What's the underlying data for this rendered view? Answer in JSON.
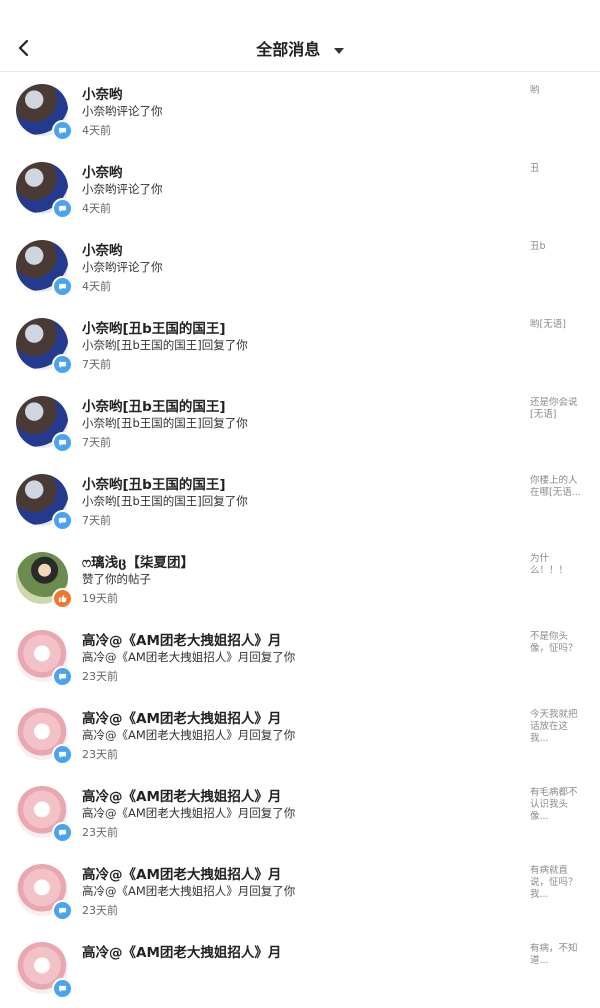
{
  "header": {
    "title": "全部消息",
    "back_icon": "chevron-left-icon",
    "dropdown_icon": "caret-down-icon"
  },
  "colors": {
    "comment_badge": "#4aa3f0",
    "like_badge": "#f2762e",
    "divider": "#e6e6e6"
  },
  "messages": [
    {
      "name": "小奈哟",
      "action": "小奈哟评论了你",
      "time": "4天前",
      "preview": "哟",
      "avatar": "basketball-player",
      "badge": "comment-icon"
    },
    {
      "name": "小奈哟",
      "action": "小奈哟评论了你",
      "time": "4天前",
      "preview": "丑",
      "avatar": "basketball-player",
      "badge": "comment-icon"
    },
    {
      "name": "小奈哟",
      "action": "小奈哟评论了你",
      "time": "4天前",
      "preview": "丑b",
      "avatar": "basketball-player",
      "badge": "comment-icon"
    },
    {
      "name": "小奈哟[丑b王国的国王]",
      "action": "小奈哟[丑b王国的国王]回复了你",
      "time": "7天前",
      "preview": "哟[无语]",
      "avatar": "basketball-player",
      "badge": "comment-icon"
    },
    {
      "name": "小奈哟[丑b王国的国王]",
      "action": "小奈哟[丑b王国的国王]回复了你",
      "time": "7天前",
      "preview": "还是你会说[无语]",
      "avatar": "basketball-player",
      "badge": "comment-icon"
    },
    {
      "name": "小奈哟[丑b王国的国王]",
      "action": "小奈哟[丑b王国的国王]回复了你",
      "time": "7天前",
      "preview": "你楼上的人在哪[无语...",
      "avatar": "basketball-player",
      "badge": "comment-icon"
    },
    {
      "name": "ෆ璃浅ც【柒夏团】",
      "action": "赞了你的帖子",
      "time": "19天前",
      "preview": "为什么！！！",
      "avatar": "girl-photo",
      "badge": "thumbs-up-icon"
    },
    {
      "name": "高冷@《AM团老大拽姐招人》月",
      "action": "高冷@《AM团老大拽姐招人》月回复了你",
      "time": "23天前",
      "preview": "不是你头像，怔吗？",
      "avatar": "anime-girl",
      "badge": "comment-icon"
    },
    {
      "name": "高冷@《AM团老大拽姐招人》月",
      "action": "高冷@《AM团老大拽姐招人》月回复了你",
      "time": "23天前",
      "preview": "今天我就把话放在这我...",
      "avatar": "anime-girl",
      "badge": "comment-icon"
    },
    {
      "name": "高冷@《AM团老大拽姐招人》月",
      "action": "高冷@《AM团老大拽姐招人》月回复了你",
      "time": "23天前",
      "preview": "有毛病都不认识我头像...",
      "avatar": "anime-girl",
      "badge": "comment-icon"
    },
    {
      "name": "高冷@《AM团老大拽姐招人》月",
      "action": "高冷@《AM团老大拽姐招人》月回复了你",
      "time": "23天前",
      "preview": "有病就直说，怔吗？我...",
      "avatar": "anime-girl",
      "badge": "comment-icon"
    },
    {
      "name": "高冷@《AM团老大拽姐招人》月",
      "action": "",
      "time": "",
      "preview": "有病，不知道...",
      "avatar": "anime-girl",
      "badge": "comment-icon"
    }
  ]
}
